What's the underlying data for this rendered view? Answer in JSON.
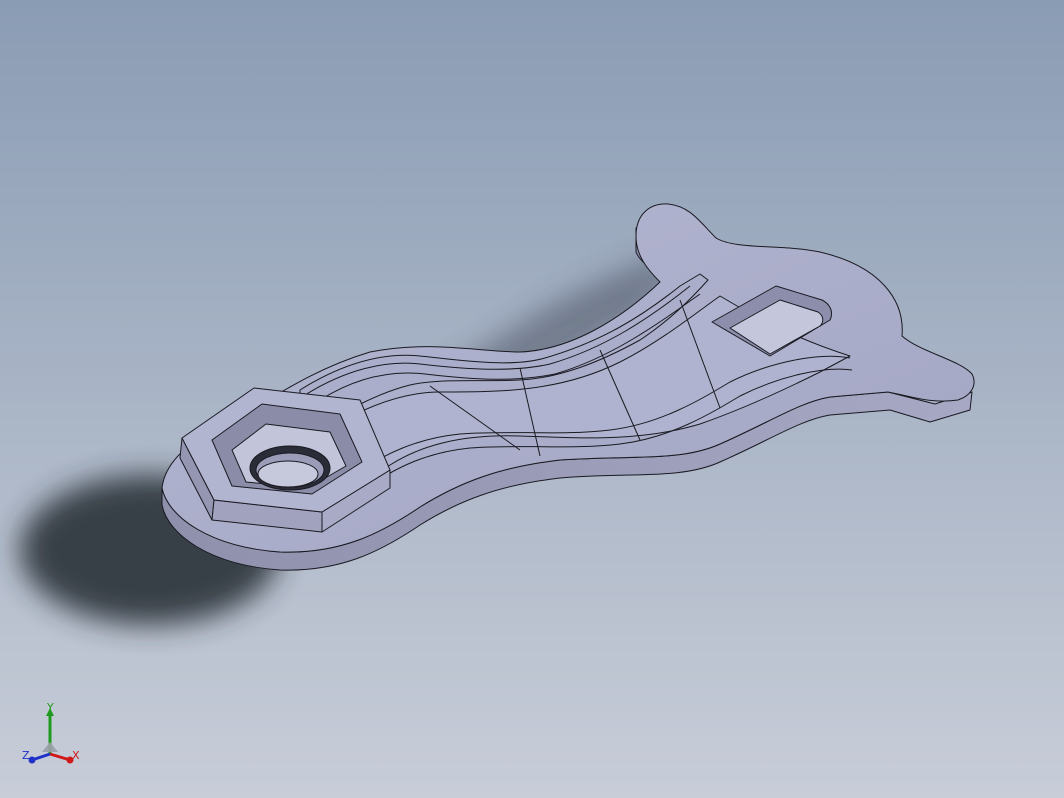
{
  "viewport": {
    "background_top": "#8a9cb4",
    "background_bottom": "#c8cdd8",
    "part_face_color": "#a6a9c6",
    "part_side_color": "#9a9cb8",
    "edge_color": "#1a1a22"
  },
  "triad": {
    "x_label": "X",
    "y_label": "Y",
    "z_label": "Z",
    "x_color": "#d01818",
    "y_color": "#1f9a1f",
    "z_color": "#2030c8"
  }
}
